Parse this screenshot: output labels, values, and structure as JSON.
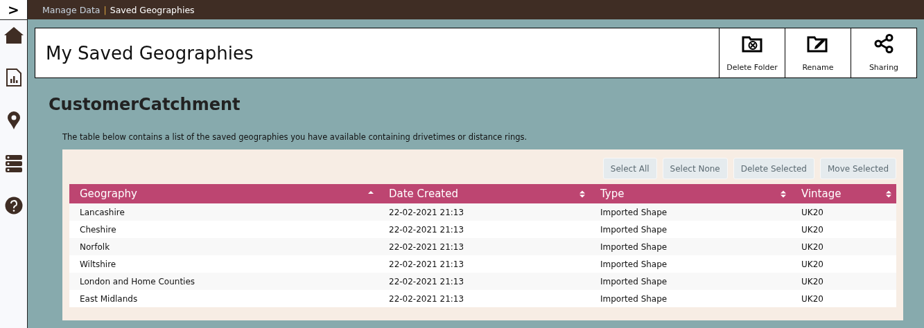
{
  "breadcrumb": {
    "parent": "Manage Data",
    "separator": "|",
    "current": "Saved Geographies"
  },
  "sidebar": {
    "toggle": ">",
    "items": [
      {
        "kind": "home"
      },
      {
        "kind": "report"
      },
      {
        "kind": "pin"
      },
      {
        "kind": "data"
      },
      {
        "kind": "help"
      }
    ]
  },
  "page_title": "My Saved Geographies",
  "toolbar": [
    {
      "kind": "delete-folder",
      "label": "Delete Folder"
    },
    {
      "kind": "rename",
      "label": "Rename"
    },
    {
      "kind": "share",
      "label": "Sharing"
    }
  ],
  "folder_name": "CustomerCatchment",
  "description": "The table below contains a list of the saved geographies you have available containing drivetimes or distance rings.",
  "table_actions": [
    "Select All",
    "Select None",
    "Delete Selected",
    "Move Selected"
  ],
  "table": {
    "columns": [
      {
        "label": "Geography",
        "sorted": true
      },
      {
        "label": "Date Created",
        "sorted": false
      },
      {
        "label": "Type",
        "sorted": false
      },
      {
        "label": "Vintage",
        "sorted": false
      }
    ],
    "rows": [
      [
        "Lancashire",
        "22-02-2021 21:13",
        "Imported Shape",
        "UK20"
      ],
      [
        "Cheshire",
        "22-02-2021 21:13",
        "Imported Shape",
        "UK20"
      ],
      [
        "Norfolk",
        "22-02-2021 21:13",
        "Imported Shape",
        "UK20"
      ],
      [
        "Wiltshire",
        "22-02-2021 21:13",
        "Imported Shape",
        "UK20"
      ],
      [
        "London and Home Counties",
        "22-02-2021 21:13",
        "Imported Shape",
        "UK20"
      ],
      [
        "East Midlands",
        "22-02-2021 21:13",
        "Imported Shape",
        "UK20"
      ]
    ]
  }
}
